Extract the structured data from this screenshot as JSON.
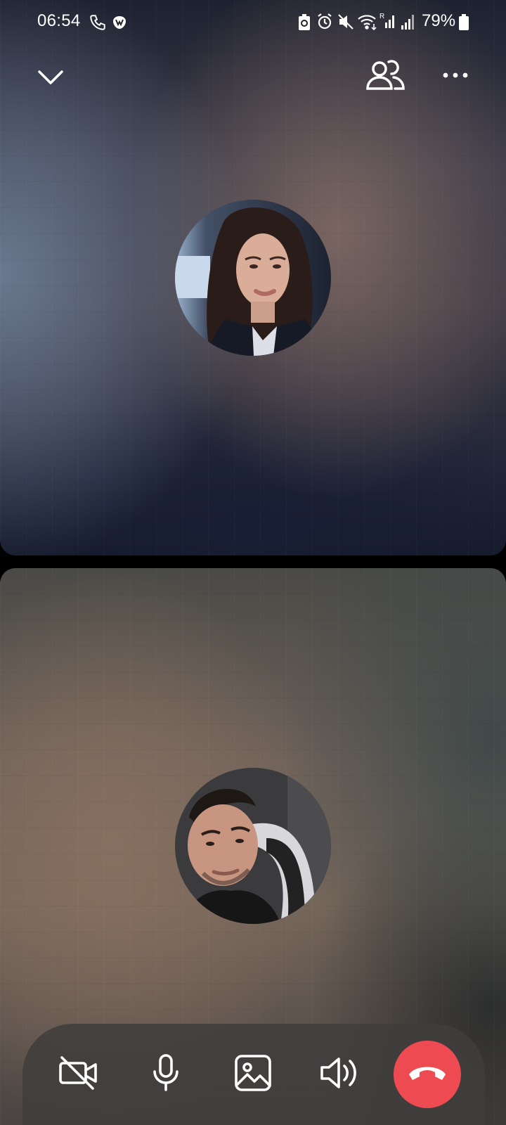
{
  "status_bar": {
    "time": "06:54",
    "battery_percent": "79%",
    "icons": [
      "phone-call-icon",
      "malwarebytes-icon",
      "battery-saver-icon",
      "alarm-icon",
      "mute-icon",
      "wifi-icon",
      "signal-r-icon",
      "signal-icon",
      "battery-icon"
    ]
  },
  "top_bar": {
    "minimize_icon": "chevron-down-icon",
    "participants_icon": "people-icon",
    "more_icon": "more-dots-icon"
  },
  "participants": [
    {
      "role": "remote",
      "avatar_icon": "remote-user-avatar"
    },
    {
      "role": "self",
      "avatar_icon": "self-user-avatar"
    }
  ],
  "controls": [
    {
      "icon": "video-off-icon"
    },
    {
      "icon": "microphone-icon"
    },
    {
      "icon": "image-icon"
    },
    {
      "icon": "speaker-icon"
    },
    {
      "icon": "end-call-icon"
    }
  ],
  "colors": {
    "end_call": "#ee4a52",
    "control_bar": "#403e3c"
  }
}
